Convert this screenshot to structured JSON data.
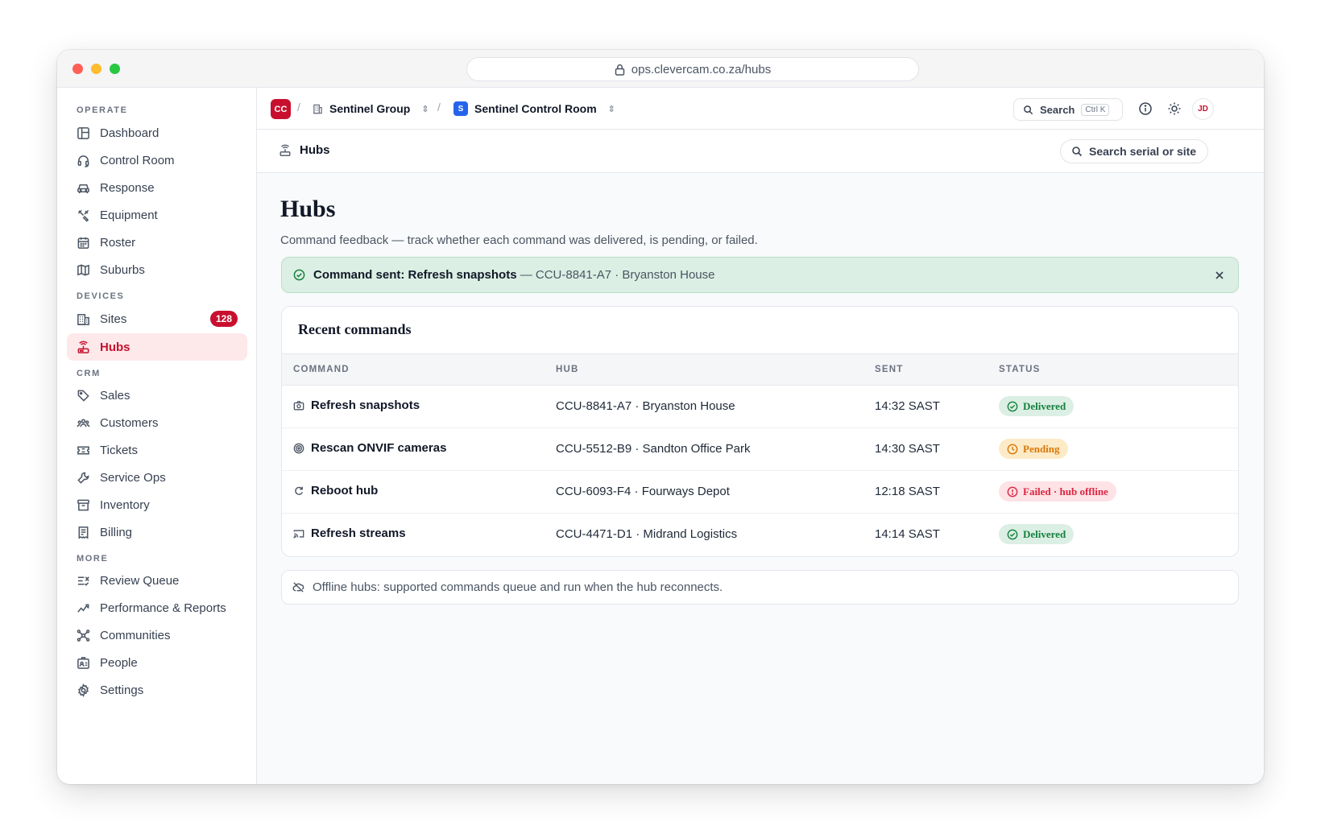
{
  "browser": {
    "url": "ops.clevercam.co.za/hubs"
  },
  "sidebar": {
    "sections": [
      {
        "label": "OPERATE",
        "items": [
          {
            "label": "Dashboard",
            "icon": "dashboard-icon"
          },
          {
            "label": "Control Room",
            "icon": "headset-icon"
          },
          {
            "label": "Response",
            "icon": "car-icon"
          },
          {
            "label": "Equipment",
            "icon": "tools-icon"
          },
          {
            "label": "Roster",
            "icon": "calendar-icon"
          },
          {
            "label": "Suburbs",
            "icon": "map-icon"
          }
        ]
      },
      {
        "label": "DEVICES",
        "items": [
          {
            "label": "Sites",
            "icon": "building-icon",
            "badge": "128"
          },
          {
            "label": "Hubs",
            "icon": "router-icon",
            "active": true
          }
        ]
      },
      {
        "label": "CRM",
        "items": [
          {
            "label": "Sales",
            "icon": "tag-icon"
          },
          {
            "label": "Customers",
            "icon": "users-icon"
          },
          {
            "label": "Tickets",
            "icon": "ticket-icon"
          },
          {
            "label": "Service Ops",
            "icon": "wrench-icon"
          },
          {
            "label": "Inventory",
            "icon": "archive-icon"
          },
          {
            "label": "Billing",
            "icon": "receipt-icon"
          }
        ]
      },
      {
        "label": "MORE",
        "items": [
          {
            "label": "Review Queue",
            "icon": "list-check-icon"
          },
          {
            "label": "Performance & Reports",
            "icon": "trend-icon"
          },
          {
            "label": "Communities",
            "icon": "network-icon"
          },
          {
            "label": "People",
            "icon": "id-card-icon"
          },
          {
            "label": "Settings",
            "icon": "gear-icon"
          }
        ]
      }
    ]
  },
  "topbar": {
    "org_logo": "CC",
    "org_name": "Sentinel Group",
    "room_badge": "S",
    "room_name": "Sentinel Control Room",
    "search_label": "Search",
    "search_shortcut": "Ctrl K",
    "avatar": "JD"
  },
  "subheader": {
    "title": "Hubs",
    "search_placeholder": "Search serial or site"
  },
  "page": {
    "title": "Hubs",
    "description": "Command feedback — track whether each command was delivered, is pending, or failed."
  },
  "toast": {
    "title": "Command sent: Refresh snapshots",
    "meta": "— CCU-8841-A7 · Bryanston House"
  },
  "table": {
    "title": "Recent commands",
    "columns": [
      "COMMAND",
      "HUB",
      "SENT",
      "STATUS"
    ],
    "rows": [
      {
        "command": "Refresh snapshots",
        "icon": "camera-icon",
        "hub": "CCU-8841-A7 · Bryanston House",
        "sent": "14:32 SAST",
        "status": "Delivered",
        "status_type": "delivered"
      },
      {
        "command": "Rescan ONVIF cameras",
        "icon": "radar-icon",
        "hub": "CCU-5512-B9 · Sandton Office Park",
        "sent": "14:30 SAST",
        "status": "Pending",
        "status_type": "pending"
      },
      {
        "command": "Reboot hub",
        "icon": "refresh-icon",
        "hub": "CCU-6093-F4 · Fourways Depot",
        "sent": "12:18 SAST",
        "status": "Failed · hub offline",
        "status_type": "failed"
      },
      {
        "command": "Refresh streams",
        "icon": "cast-icon",
        "hub": "CCU-4471-D1 · Midrand Logistics",
        "sent": "14:14 SAST",
        "status": "Delivered",
        "status_type": "delivered"
      }
    ]
  },
  "offline_note": "Offline hubs: supported commands queue and run when the hub reconnects.",
  "colors": {
    "brand": "#c8102e",
    "delivered": "#15803d",
    "pending": "#d97706",
    "failed": "#dc2641",
    "room": "#2563eb"
  }
}
